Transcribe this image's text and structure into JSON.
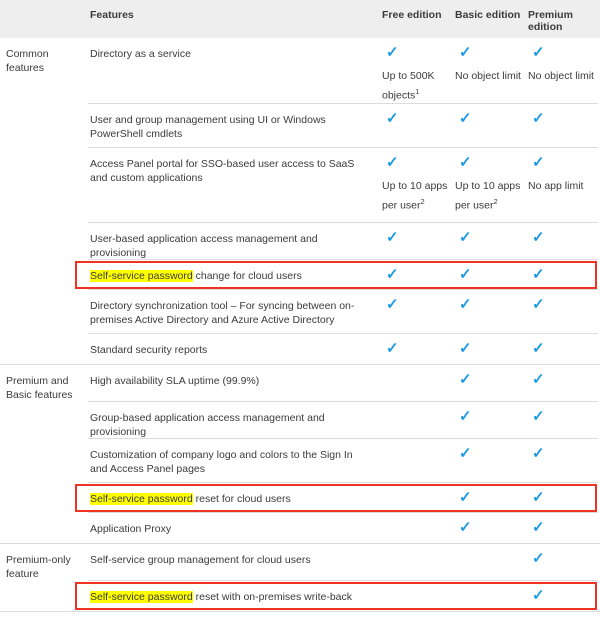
{
  "table": {
    "headers": {
      "group": "",
      "feature": "Features",
      "free": "Free edition",
      "basic": "Basic edition",
      "premium": "Premium edition"
    },
    "check_glyph": "✓",
    "check_color": "#1b9ae5",
    "highlight_color": "#ffff00",
    "outline_color": "#ee3322",
    "sections": [
      {
        "group_label": "Common features",
        "rows": [
          {
            "feature_prefix": "",
            "feature_highlight": "",
            "feature_suffix": "Directory as a service",
            "boxed": false,
            "free": "✓",
            "basic": "✓",
            "premium": "✓",
            "free_note": "Up to 500K objects",
            "free_note_sup": "1",
            "basic_note": "No object limit",
            "basic_note_sup": "",
            "premium_note": "No object limit",
            "premium_note_sup": ""
          },
          {
            "feature_prefix": "",
            "feature_highlight": "",
            "feature_suffix": "User and group management using UI or Windows PowerShell cmdlets",
            "boxed": false,
            "free": "✓",
            "basic": "✓",
            "premium": "✓",
            "free_note": "",
            "free_note_sup": "",
            "basic_note": "",
            "basic_note_sup": "",
            "premium_note": "",
            "premium_note_sup": ""
          },
          {
            "feature_prefix": "",
            "feature_highlight": "",
            "feature_suffix": "Access Panel portal for SSO-based user access to SaaS and custom applications",
            "boxed": false,
            "free": "✓",
            "basic": "✓",
            "premium": "✓",
            "free_note": "Up to 10 apps per user",
            "free_note_sup": "2",
            "basic_note": "Up to 10 apps per user",
            "basic_note_sup": "2",
            "premium_note": "No app limit",
            "premium_note_sup": ""
          },
          {
            "feature_prefix": "",
            "feature_highlight": "",
            "feature_suffix": "User-based application access management and provisioning",
            "boxed": false,
            "free": "✓",
            "basic": "✓",
            "premium": "✓",
            "free_note": "",
            "free_note_sup": "",
            "basic_note": "",
            "basic_note_sup": "",
            "premium_note": "",
            "premium_note_sup": ""
          },
          {
            "feature_prefix": "",
            "feature_highlight": "Self-service password",
            "feature_suffix": " change for cloud users",
            "boxed": true,
            "free": "✓",
            "basic": "✓",
            "premium": "✓",
            "free_note": "",
            "free_note_sup": "",
            "basic_note": "",
            "basic_note_sup": "",
            "premium_note": "",
            "premium_note_sup": ""
          },
          {
            "feature_prefix": "",
            "feature_highlight": "",
            "feature_suffix": "Directory synchronization tool – For syncing between on-premises Active Directory and Azure Active Directory",
            "boxed": false,
            "free": "✓",
            "basic": "✓",
            "premium": "✓",
            "free_note": "",
            "free_note_sup": "",
            "basic_note": "",
            "basic_note_sup": "",
            "premium_note": "",
            "premium_note_sup": ""
          },
          {
            "feature_prefix": "",
            "feature_highlight": "",
            "feature_suffix": "Standard security reports",
            "boxed": false,
            "free": "✓",
            "basic": "✓",
            "premium": "✓",
            "free_note": "",
            "free_note_sup": "",
            "basic_note": "",
            "basic_note_sup": "",
            "premium_note": "",
            "premium_note_sup": ""
          }
        ]
      },
      {
        "group_label": "Premium and Basic features",
        "rows": [
          {
            "feature_prefix": "",
            "feature_highlight": "",
            "feature_suffix": "High availability SLA uptime (99.9%)",
            "boxed": false,
            "free": "",
            "basic": "✓",
            "premium": "✓",
            "free_note": "",
            "free_note_sup": "",
            "basic_note": "",
            "basic_note_sup": "",
            "premium_note": "",
            "premium_note_sup": ""
          },
          {
            "feature_prefix": "",
            "feature_highlight": "",
            "feature_suffix": "Group-based application access management and provisioning",
            "boxed": false,
            "free": "",
            "basic": "✓",
            "premium": "✓",
            "free_note": "",
            "free_note_sup": "",
            "basic_note": "",
            "basic_note_sup": "",
            "premium_note": "",
            "premium_note_sup": ""
          },
          {
            "feature_prefix": "",
            "feature_highlight": "",
            "feature_suffix": "Customization of company logo and colors to the Sign In and Access Panel pages",
            "boxed": false,
            "free": "",
            "basic": "✓",
            "premium": "✓",
            "free_note": "",
            "free_note_sup": "",
            "basic_note": "",
            "basic_note_sup": "",
            "premium_note": "",
            "premium_note_sup": ""
          },
          {
            "feature_prefix": "",
            "feature_highlight": "Self-service password",
            "feature_suffix": " reset for cloud users",
            "boxed": true,
            "free": "",
            "basic": "✓",
            "premium": "✓",
            "free_note": "",
            "free_note_sup": "",
            "basic_note": "",
            "basic_note_sup": "",
            "premium_note": "",
            "premium_note_sup": ""
          },
          {
            "feature_prefix": "",
            "feature_highlight": "",
            "feature_suffix": "Application Proxy",
            "boxed": false,
            "free": "",
            "basic": "✓",
            "premium": "✓",
            "free_note": "",
            "free_note_sup": "",
            "basic_note": "",
            "basic_note_sup": "",
            "premium_note": "",
            "premium_note_sup": ""
          }
        ]
      },
      {
        "group_label": "Premium-only feature",
        "rows": [
          {
            "feature_prefix": "",
            "feature_highlight": "",
            "feature_suffix": "Self-service group management for cloud users",
            "boxed": false,
            "free": "",
            "basic": "",
            "premium": "✓",
            "free_note": "",
            "free_note_sup": "",
            "basic_note": "",
            "basic_note_sup": "",
            "premium_note": "",
            "premium_note_sup": ""
          },
          {
            "feature_prefix": "",
            "feature_highlight": "Self-service password",
            "feature_suffix": " reset with on-premises write-back",
            "boxed": true,
            "free": "",
            "basic": "",
            "premium": "✓",
            "free_note": "",
            "free_note_sup": "",
            "basic_note": "",
            "basic_note_sup": "",
            "premium_note": "",
            "premium_note_sup": ""
          }
        ]
      }
    ]
  }
}
